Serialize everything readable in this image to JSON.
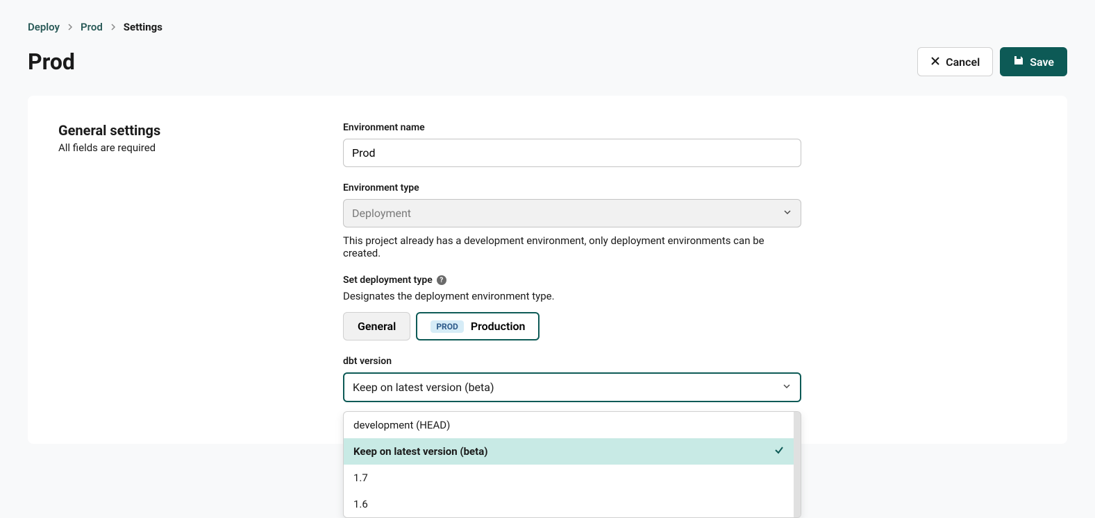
{
  "breadcrumb": {
    "items": [
      {
        "label": "Deploy"
      },
      {
        "label": "Prod"
      }
    ],
    "current": "Settings"
  },
  "header": {
    "title": "Prod",
    "cancel_label": "Cancel",
    "save_label": "Save"
  },
  "section": {
    "title": "General settings",
    "subtitle": "All fields are required"
  },
  "fields": {
    "env_name": {
      "label": "Environment name",
      "value": "Prod"
    },
    "env_type": {
      "label": "Environment type",
      "value": "Deployment",
      "help": "This project already has a development environment, only deployment environments can be created."
    },
    "deploy_type": {
      "label": "Set deployment type",
      "desc": "Designates the deployment environment type.",
      "options": {
        "general": "General",
        "prod_badge": "PROD",
        "production": "Production"
      }
    },
    "dbt_version": {
      "label": "dbt version",
      "selected": "Keep on latest version (beta)",
      "options": [
        {
          "label": "development (HEAD)",
          "selected": false
        },
        {
          "label": "Keep on latest version (beta)",
          "selected": true
        },
        {
          "label": "1.7",
          "selected": false
        },
        {
          "label": "1.6",
          "selected": false
        }
      ]
    }
  }
}
